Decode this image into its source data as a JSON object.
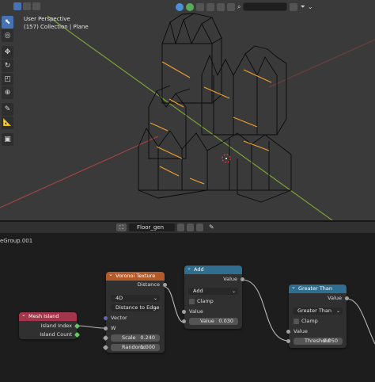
{
  "viewport": {
    "overlay_line1": "User Perspective",
    "overlay_line2": "(157) Collection | Plane",
    "toolbar": [
      {
        "icon": "select-box-icon",
        "glyph": "⬉",
        "active": true
      },
      {
        "icon": "cursor-icon",
        "glyph": "◎"
      },
      {
        "icon": "move-icon",
        "glyph": "✥"
      },
      {
        "icon": "rotate-icon",
        "glyph": "↻"
      },
      {
        "icon": "scale-icon",
        "glyph": "◰"
      },
      {
        "icon": "transform-icon",
        "glyph": "⊕"
      },
      {
        "icon": "annotate-icon",
        "glyph": "✎"
      },
      {
        "icon": "measure-icon",
        "glyph": "📐"
      },
      {
        "icon": "add-cube-icon",
        "glyph": "▣"
      }
    ],
    "colors": {
      "wire": "#0a0a0a",
      "highlight": "#f0a030",
      "x_axis": "#a04545",
      "y_axis": "#7da038"
    }
  },
  "node_header": {
    "editor_type": "⛶",
    "nodegroup": "Floor_gen",
    "breadcrumb": "eGroup.001"
  },
  "nodes": {
    "mesh_island": {
      "title": "Mesh Island",
      "outputs": [
        "Island Index",
        "Island Count"
      ],
      "color": "#a3364a"
    },
    "voronoi": {
      "title": "Voronoi Texture",
      "output": "Distance",
      "dimensions": "4D",
      "feature": "Distance to Edge",
      "vector": "Vector",
      "w": "W",
      "scale_label": "Scale",
      "scale_value": "0.240",
      "randomness_label": "Randomn",
      "randomness_value": "1.000",
      "color": "#b45a28"
    },
    "add": {
      "title": "Add",
      "output": "Value",
      "operation": "Add",
      "clamp": "Clamp",
      "input": "Value",
      "value_label": "Value",
      "value": "0.030",
      "color": "#2f6e8f"
    },
    "greater_than": {
      "title": "Greater Than",
      "output": "Value",
      "operation": "Greater Than",
      "clamp": "Clamp",
      "input": "Value",
      "threshold_label": "Threshold",
      "threshold_value": "0.050",
      "color": "#2f6e8f"
    }
  }
}
